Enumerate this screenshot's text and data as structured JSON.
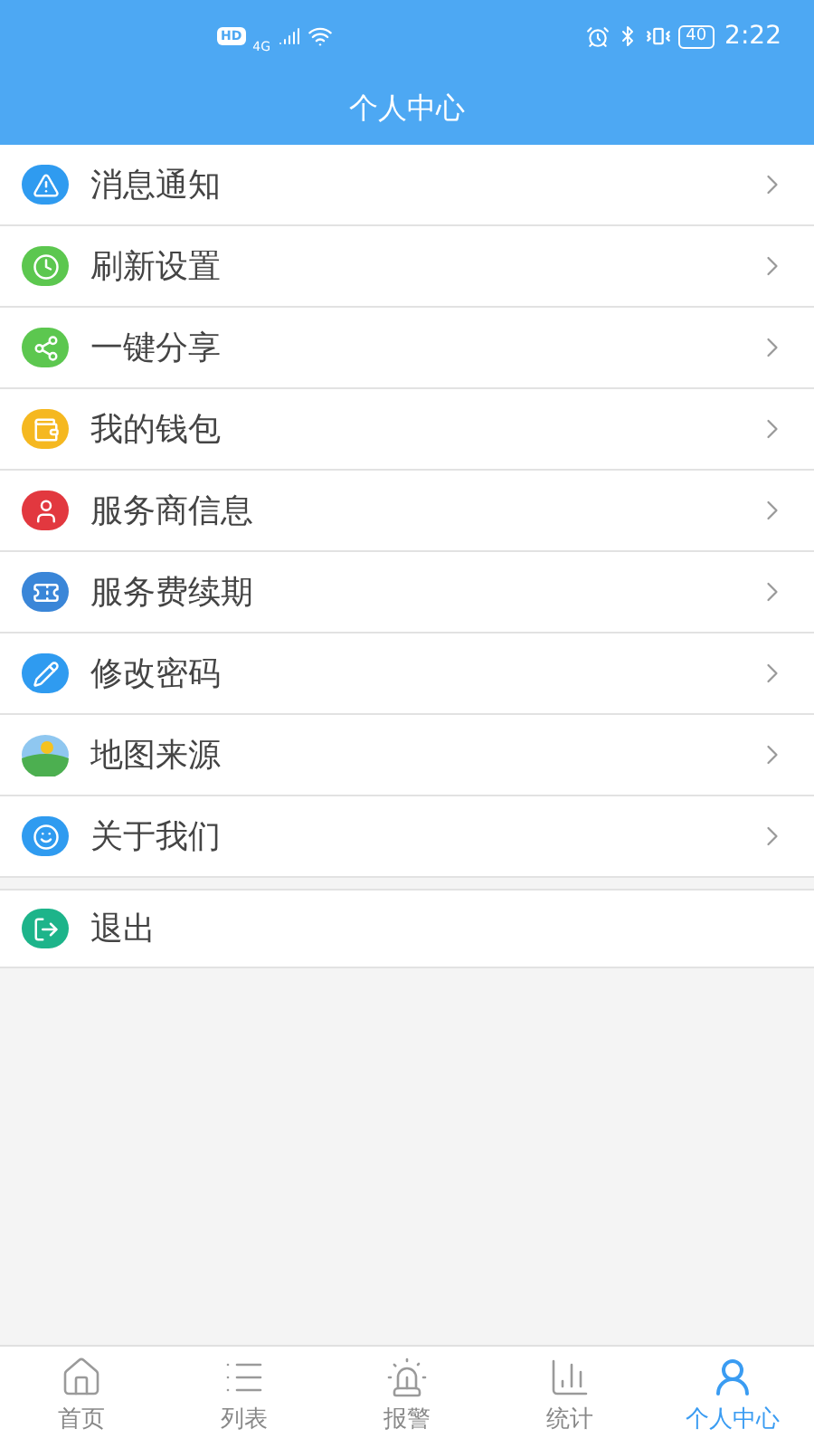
{
  "status_bar": {
    "network_badge": "HD",
    "network_type": "4G",
    "battery": "40",
    "time": "2:22"
  },
  "title": "个人中心",
  "menu": [
    {
      "label": "消息通知",
      "kind": "alert",
      "color": "#2f9bf0"
    },
    {
      "label": "刷新设置",
      "kind": "refresh",
      "color": "#5cc74f"
    },
    {
      "label": "一键分享",
      "kind": "share",
      "color": "#5cc74f"
    },
    {
      "label": "我的钱包",
      "kind": "wallet",
      "color": "#f5b820"
    },
    {
      "label": "服务商信息",
      "kind": "user",
      "color": "#e2383f"
    },
    {
      "label": "服务费续期",
      "kind": "ticket",
      "color": "#3a86d8"
    },
    {
      "label": "修改密码",
      "kind": "pencil",
      "color": "#2f9bf0"
    },
    {
      "label": "地图来源",
      "kind": "map",
      "color": "#4caf50"
    },
    {
      "label": "关于我们",
      "kind": "about",
      "color": "#2f9bf0"
    }
  ],
  "logout": {
    "label": "退出",
    "color": "#1db48a"
  },
  "tabs": [
    {
      "label": "首页",
      "kind": "home",
      "selected": false
    },
    {
      "label": "列表",
      "kind": "list",
      "selected": false
    },
    {
      "label": "报警",
      "kind": "alarm",
      "selected": false
    },
    {
      "label": "统计",
      "kind": "stats",
      "selected": false
    },
    {
      "label": "个人中心",
      "kind": "person",
      "selected": true
    }
  ]
}
